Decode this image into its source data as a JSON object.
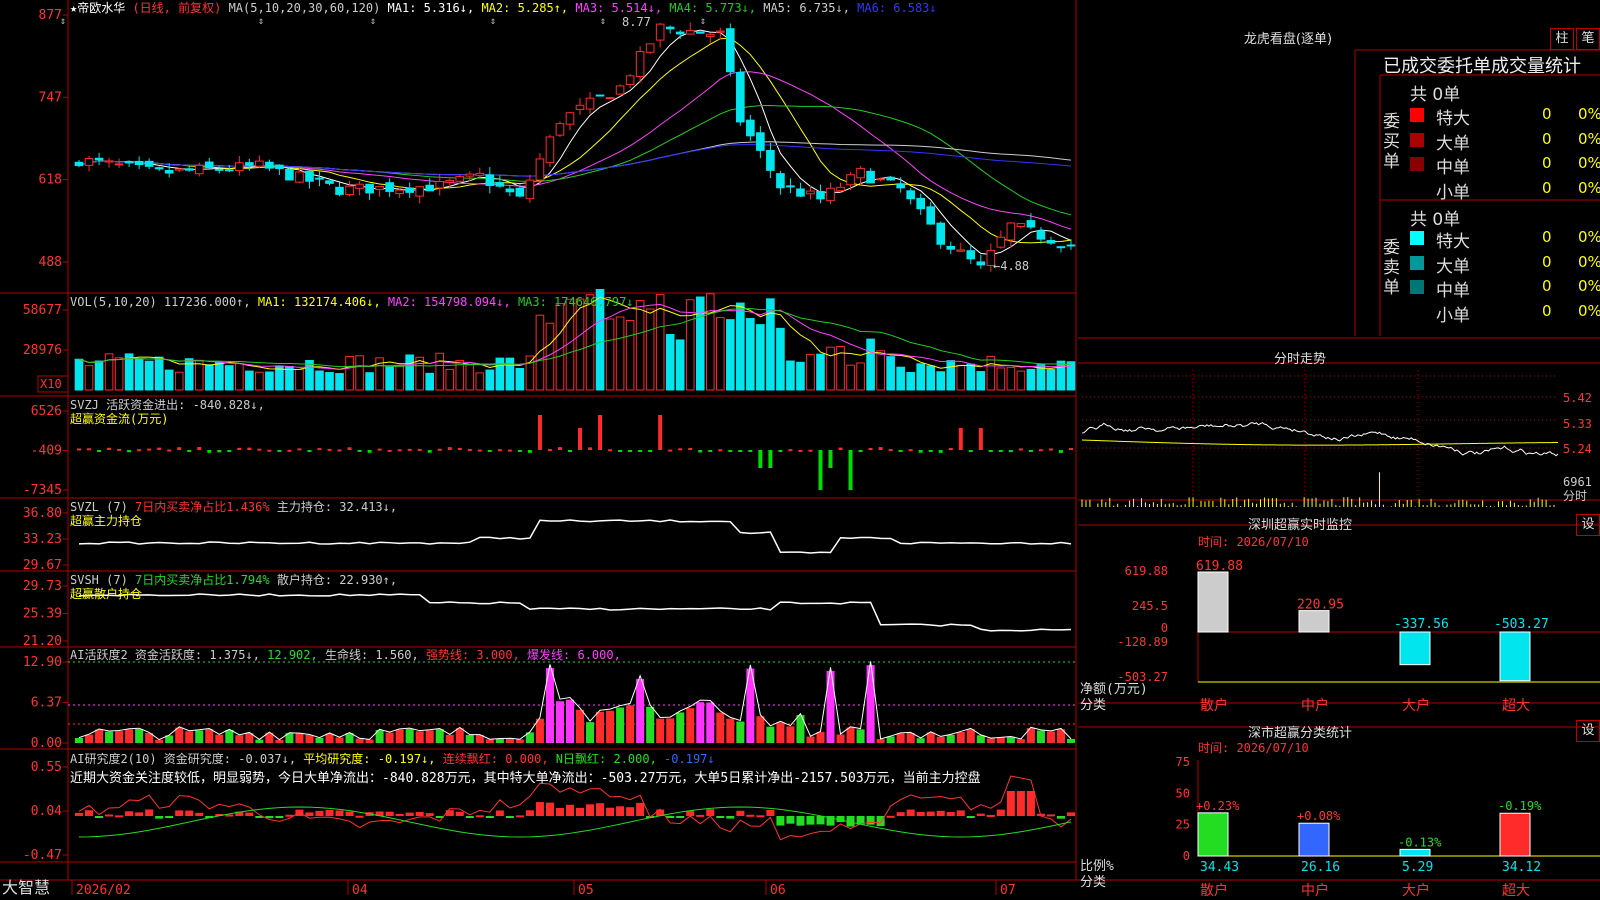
{
  "stock": {
    "name": "帝欧水华",
    "period_label": "(日线, 前复权)"
  },
  "colors": {
    "up": "#ff2a2a",
    "down": "#00e5ee",
    "grid": "#b00000",
    "ma1": "#ffffff",
    "ma2": "#ffff00",
    "ma3": "#ff40ff",
    "ma4": "#22cc22",
    "ma5": "#cccccc",
    "ma6": "#3333ff"
  },
  "price_panel": {
    "header": [
      {
        "t": "MA(5,10,20,30,60,120)",
        "c": "#cccccc"
      },
      {
        "t": "MA1: 5.316↓,",
        "c": "#ffffff"
      },
      {
        "t": "MA2: 5.285↑,",
        "c": "#ffff00"
      },
      {
        "t": "MA3: 5.514↓,",
        "c": "#ff40ff"
      },
      {
        "t": "MA4: 5.773↓,",
        "c": "#22cc22"
      },
      {
        "t": "MA5: 6.735↓,",
        "c": "#cccccc"
      },
      {
        "t": "MA6: 6.583↓",
        "c": "#3333ff"
      }
    ],
    "yticks": [
      "877",
      "747",
      "618",
      "488"
    ],
    "high_label": "8.77",
    "low_label": "←4.88"
  },
  "vol_panel": {
    "header": [
      {
        "t": "VOL(5,10,20) 117236.000↑,",
        "c": "#cccccc"
      },
      {
        "t": "MA1: 132174.406↓,",
        "c": "#ffff00"
      },
      {
        "t": "MA2: 154798.094↓,",
        "c": "#ff40ff"
      },
      {
        "t": "MA3: 174646.797↓",
        "c": "#22cc22"
      }
    ],
    "yticks": [
      "58677",
      "28976"
    ],
    "unit": "X10"
  },
  "svzj_panel": {
    "header": [
      {
        "t": "SVZJ  活跃资金进出: -840.828↓,",
        "c": "#cccccc"
      }
    ],
    "sub": "超赢资金流(万元)",
    "yticks": [
      "6526",
      "-409",
      "-7345"
    ]
  },
  "svzl_panel": {
    "header": [
      {
        "t": "SVZL (7)",
        "c": "#cccccc"
      },
      {
        "t": "7日内买卖净占比1.436%",
        "c": "#ff3333"
      },
      {
        "t": "主力持仓: 32.413↓,",
        "c": "#cccccc"
      }
    ],
    "sub": "超赢主力持仓",
    "yticks": [
      "36.80",
      "33.23",
      "29.67"
    ]
  },
  "svsh_panel": {
    "header": [
      {
        "t": "SVSH (7)",
        "c": "#cccccc"
      },
      {
        "t": "7日内买卖净占比1.794%",
        "c": "#22dd22"
      },
      {
        "t": "散户持仓: 22.930↑,",
        "c": "#cccccc"
      }
    ],
    "sub": "超赢散户持仓",
    "yticks": [
      "29.73",
      "25.39",
      "21.20"
    ]
  },
  "ai_panel": {
    "header": [
      {
        "t": "AI活跃度2 资金活跃度: 1.375↓,",
        "c": "#cccccc"
      },
      {
        "t": "12.902,",
        "c": "#22dd22"
      },
      {
        "t": "生命线: 1.560,",
        "c": "#cccccc"
      },
      {
        "t": "强势线: 3.000,",
        "c": "#ff3333"
      },
      {
        "t": "爆发线: 6.000,",
        "c": "#ff40ff"
      }
    ],
    "yticks": [
      "12.90",
      "6.37",
      "0.00"
    ]
  },
  "research_panel": {
    "header": [
      {
        "t": "AI研究度2(10) 资金研究度: -0.037↓,",
        "c": "#cccccc"
      },
      {
        "t": "平均研究度: -0.197↓,",
        "c": "#ffff00"
      },
      {
        "t": "连续飘红: 0.000,",
        "c": "#ff3333"
      },
      {
        "t": "N日飘红: 2.000,",
        "c": "#22dd22"
      },
      {
        "t": "-0.197↓",
        "c": "#3366ff"
      }
    ],
    "comment": "近期大资金关注度较低，明显弱势，今日大单净流出：-840.828万元，其中特大单净流出：-503.27万元，大单5日累计净出-2157.503万元，当前主力控盘",
    "yticks": [
      "0.55",
      "0.04",
      "-0.47"
    ]
  },
  "xaxis": {
    "labels": [
      "2026/02",
      "04",
      "05",
      "06",
      "07"
    ],
    "brand": "大智慧"
  },
  "right": {
    "lhb_title": "龙虎看盘(逐单)",
    "btn1": "柱",
    "btn2": "笔",
    "stat_title": "已成交委托单成交量统计",
    "buy": {
      "side": "委买单",
      "total": "共 0单",
      "rows": [
        {
          "label": "特大",
          "n": "0",
          "p": "0%",
          "color": "#ff0000"
        },
        {
          "label": "大单",
          "n": "0",
          "p": "0%",
          "color": "#aa0000"
        },
        {
          "label": "中单",
          "n": "0",
          "p": "0%",
          "color": "#880000"
        },
        {
          "label": "小单",
          "n": "0",
          "p": "0%",
          "color": "#000000"
        }
      ]
    },
    "sell": {
      "side": "委卖单",
      "total": "共 0单",
      "rows": [
        {
          "label": "特大",
          "n": "0",
          "p": "0%",
          "color": "#00ffff"
        },
        {
          "label": "大单",
          "n": "0",
          "p": "0%",
          "color": "#009999"
        },
        {
          "label": "中单",
          "n": "0",
          "p": "0%",
          "color": "#007777"
        },
        {
          "label": "小单",
          "n": "0",
          "p": "0%",
          "color": "#000000"
        }
      ]
    },
    "intraday": {
      "title": "分时走势",
      "yticks": [
        "5.42",
        "5.33",
        "5.24"
      ],
      "vol": "6961",
      "vol_unit": "分时"
    },
    "monitor": {
      "title": "深圳超赢实时监控",
      "btn": "设",
      "date": "时间: 2026/07/10",
      "yticks": [
        "619.88",
        "245.5",
        "0",
        "-128.89",
        "-503.27"
      ],
      "ylabel": "净额(万元)",
      "xlabel": "分类",
      "bars": [
        {
          "cat": "散户",
          "v": 619.88,
          "lab": "619.88"
        },
        {
          "cat": "中户",
          "v": 220.95,
          "lab": "220.95"
        },
        {
          "cat": "大户",
          "v": -337.56,
          "lab": "-337.56"
        },
        {
          "cat": "超大",
          "v": -503.27,
          "lab": "-503.27"
        }
      ]
    },
    "classify": {
      "title": "深市超赢分类统计",
      "btn": "设",
      "date": "时间: 2026/07/10",
      "yticks": [
        "75",
        "50",
        "25",
        "0"
      ],
      "ylabel": "比例%",
      "xlabel": "分类",
      "bars": [
        {
          "cat": "散户",
          "v": 34.43,
          "chg": "+0.23%",
          "lab": "34.43",
          "color": "#22dd22"
        },
        {
          "cat": "中户",
          "v": 26.16,
          "chg": "+0.08%",
          "lab": "26.16",
          "color": "#3366ff"
        },
        {
          "cat": "大户",
          "v": 5.29,
          "chg": "-0.13%",
          "lab": "5.29",
          "color": "#00e5ee"
        },
        {
          "cat": "超大",
          "v": 34.12,
          "chg": "-0.19%",
          "lab": "34.12",
          "color": "#ff2a2a"
        }
      ]
    }
  }
}
